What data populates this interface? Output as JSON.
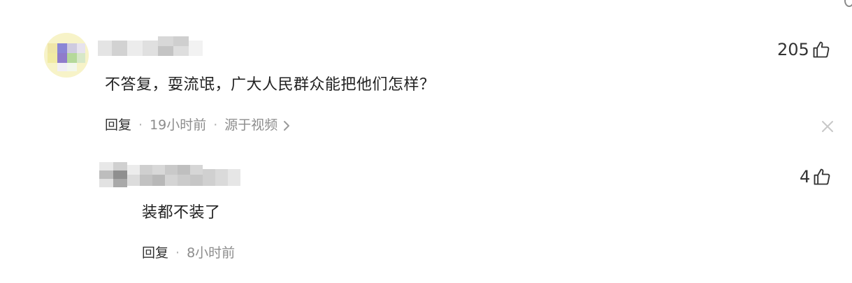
{
  "comment": {
    "text": "不答复，耍流氓，广大人民群众能把他们怎样？",
    "reply_label": "回复",
    "time": "19小时前",
    "source": "源于视频",
    "likes": "205",
    "icons": {
      "like": "thumbs-up-icon",
      "source_arrow": "chevron-right-icon",
      "close": "close-icon"
    }
  },
  "reply": {
    "text": "装都不装了",
    "reply_label": "回复",
    "time": "8小时前",
    "likes": "4",
    "icons": {
      "like": "thumbs-up-icon"
    }
  },
  "colors": {
    "text_primary": "#222222",
    "text_meta": "#8c8c8c",
    "background": "#ffffff"
  }
}
